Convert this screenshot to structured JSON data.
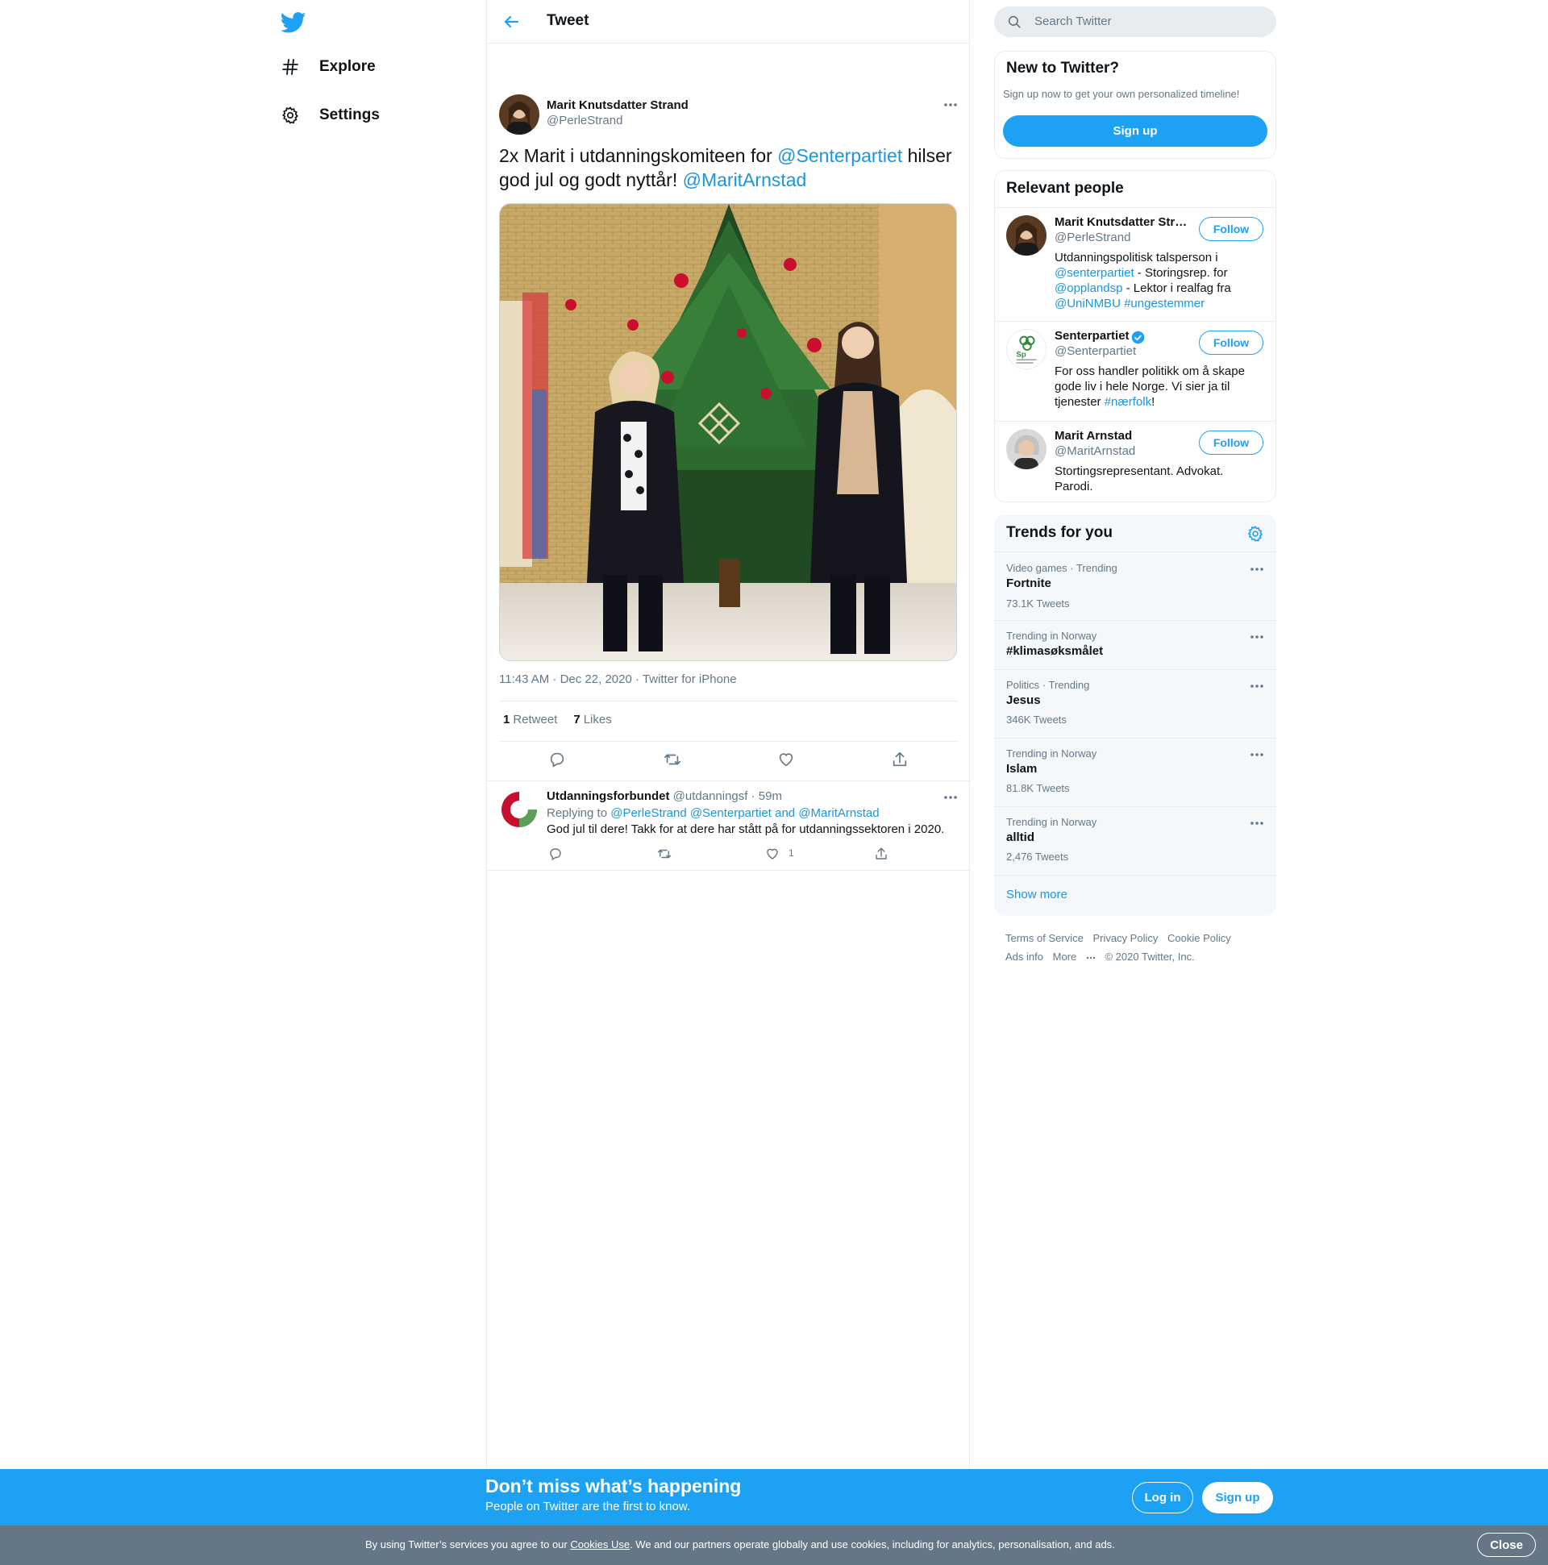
{
  "nav": {
    "logo": "twitter-bird-icon",
    "items": [
      {
        "label": "Explore",
        "icon": "hashtag-icon"
      },
      {
        "label": "Settings",
        "icon": "gear-icon"
      }
    ]
  },
  "header": {
    "title": "Tweet"
  },
  "tweet": {
    "author_name": "Marit Knutsdatter Strand",
    "author_handle": "@PerleStrand",
    "text_part1": "2x Marit i utdanningskomiteen for ",
    "mention1": "@Senterpartiet",
    "text_part2": " hilser god jul og godt nyttår! ",
    "mention2": "@MaritArnstad",
    "photo_alt": "Two women standing in front of a decorated Christmas tree",
    "timestamp": "11:43 AM · Dec 22, 2020 · Twitter for iPhone",
    "retweet_count": "1",
    "retweet_label": "Retweet",
    "like_count": "7",
    "like_label": "Likes"
  },
  "reply": {
    "name": "Utdanningsforbundet",
    "handle": "@utdanningsf",
    "time": "· 59m",
    "replying_to_label": "Replying to ",
    "replying_to_mentions": "@PerleStrand @Senterpartiet and @MaritArnstad",
    "text": "God jul til dere! Takk for at dere har stått på for utdanningssektoren i 2020.",
    "like_count": "1"
  },
  "search": {
    "placeholder": "Search Twitter"
  },
  "new_to_twitter": {
    "title": "New to Twitter?",
    "subtitle": "Sign up now to get your own personalized timeline!",
    "button": "Sign up"
  },
  "relevant_people": {
    "title": "Relevant people",
    "follow_label": "Follow",
    "people": [
      {
        "name": "Marit Knutsdatter Strand",
        "handle": "@PerleStrand"
      },
      {
        "name": "Senterpartiet",
        "handle": "@Senterpartiet"
      },
      {
        "name": "Marit Arnstad",
        "handle": "@MaritArnstad",
        "bio": "Stortingsrepresentant. Advokat. Parodi."
      }
    ],
    "bio1": {
      "t1": "Utdanningspolitisk talsperson i ",
      "m1": "@senterpartiet",
      "t2": " - Storingsrep. for ",
      "m2": "@opplandsp",
      "t3": " - Lektor i realfag fra ",
      "m3": "@UniNMBU",
      "m4": " #ungestemmer"
    },
    "bio2": {
      "t1": "For oss handler politikk om å skape gode liv i hele Norge. Vi sier ja til tjenester ",
      "m1": "#nærfolk",
      "t2": "!"
    }
  },
  "trends": {
    "title": "Trends for you",
    "items": [
      {
        "category": "Video games · Trending",
        "name": "Fortnite",
        "count": "73.1K Tweets"
      },
      {
        "category": "Trending in Norway",
        "name": "#klimasøksmålet",
        "count": ""
      },
      {
        "category": "Politics · Trending",
        "name": "Jesus",
        "count": "346K Tweets"
      },
      {
        "category": "Trending in Norway",
        "name": "Islam",
        "count": "81.8K Tweets"
      },
      {
        "category": "Trending in Norway",
        "name": "alltid",
        "count": "2,476 Tweets"
      }
    ],
    "show_more": "Show more"
  },
  "footer": {
    "links": [
      "Terms of Service",
      "Privacy Policy",
      "Cookie Policy",
      "Ads info",
      "More"
    ],
    "copyright": "© 2020 Twitter, Inc."
  },
  "banner": {
    "title": "Don’t miss what’s happening",
    "subtitle": "People on Twitter are the first to know.",
    "login": "Log in",
    "signup": "Sign up"
  },
  "cookie": {
    "text1": "By using Twitter’s services you agree to our ",
    "link": "Cookies Use",
    "text2": ". We and our partners operate globally and use cookies, including for analytics, personalisation, and ads.",
    "close": "Close"
  },
  "colors": {
    "accent": "#1da1f2",
    "link": "#1b95e0",
    "muted": "#657786",
    "border": "#e6ecf0"
  }
}
